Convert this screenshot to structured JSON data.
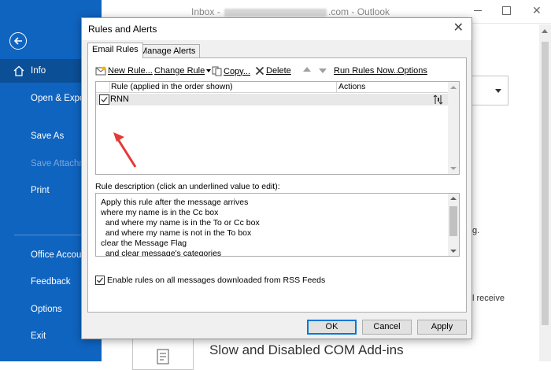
{
  "outlook": {
    "title_prefix": "Inbox - ",
    "title_suffix": ".com - Outlook",
    "sidebar": {
      "items": [
        {
          "label": "Info"
        },
        {
          "label": "Open & Export"
        },
        {
          "label": "Save As"
        },
        {
          "label": "Save Attachments"
        },
        {
          "label": "Print"
        },
        {
          "label": "Office Account"
        },
        {
          "label": "Feedback"
        },
        {
          "label": "Options"
        },
        {
          "label": "Exit"
        }
      ]
    },
    "main": {
      "text_1": "g.",
      "text_2": "l receive",
      "addins_heading": "Slow and Disabled COM Add-ins"
    }
  },
  "dialog": {
    "title": "Rules and Alerts",
    "tabs": [
      {
        "label": "Email Rules"
      },
      {
        "label": "Manage Alerts"
      }
    ],
    "toolbar": {
      "new_rule": "New Rule...",
      "change_rule": "Change Rule",
      "copy": "Copy...",
      "delete": "Delete",
      "run_rules_now": "Run Rules Now...",
      "options": "Options"
    },
    "rules_list": {
      "columns": [
        "Rule (applied in the order shown)",
        "Actions"
      ],
      "rows": [
        {
          "name": "RNN",
          "enabled": true
        }
      ]
    },
    "description_label": "Rule description (click an underlined value to edit):",
    "description_lines": [
      "Apply this rule after the message arrives",
      "where my name is in the Cc box",
      "  and where my name is in the To or Cc box",
      "  and where my name is not in the To box",
      "clear the Message Flag",
      "  and clear message's categories"
    ],
    "rss_option": {
      "label": "Enable rules on all messages downloaded from RSS Feeds",
      "checked": true
    },
    "buttons": {
      "ok": "OK",
      "cancel": "Cancel",
      "apply": "Apply"
    }
  },
  "colors": {
    "sidebar_blue": "#0f64c0",
    "sidebar_active": "#0b4f97",
    "annotation_arrow": "#e53935"
  }
}
